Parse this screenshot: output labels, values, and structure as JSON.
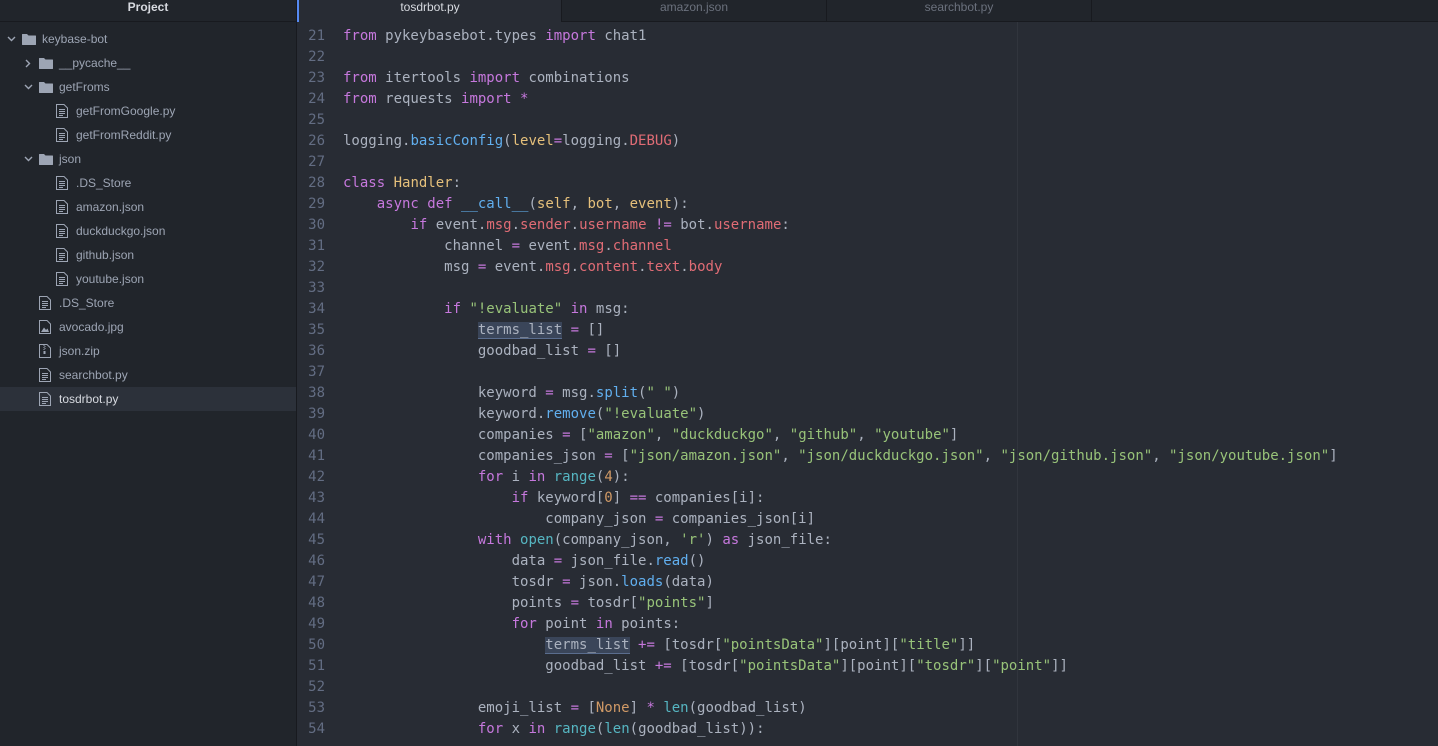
{
  "sidebar": {
    "title": "Project",
    "tree": [
      {
        "label": "keybase-bot",
        "type": "folder",
        "depth": 0,
        "expanded": true,
        "selected": false
      },
      {
        "label": "__pycache__",
        "type": "folder",
        "depth": 1,
        "expanded": false,
        "selected": false
      },
      {
        "label": "getFroms",
        "type": "folder",
        "depth": 1,
        "expanded": true,
        "selected": false
      },
      {
        "label": "getFromGoogle.py",
        "type": "file",
        "depth": 2,
        "selected": false
      },
      {
        "label": "getFromReddit.py",
        "type": "file",
        "depth": 2,
        "selected": false
      },
      {
        "label": "json",
        "type": "folder",
        "depth": 1,
        "expanded": true,
        "selected": false
      },
      {
        "label": ".DS_Store",
        "type": "file",
        "depth": 2,
        "selected": false
      },
      {
        "label": "amazon.json",
        "type": "file",
        "depth": 2,
        "selected": false
      },
      {
        "label": "duckduckgo.json",
        "type": "file",
        "depth": 2,
        "selected": false
      },
      {
        "label": "github.json",
        "type": "file",
        "depth": 2,
        "selected": false
      },
      {
        "label": "youtube.json",
        "type": "file",
        "depth": 2,
        "selected": false
      },
      {
        "label": ".DS_Store",
        "type": "file",
        "depth": 1,
        "selected": false
      },
      {
        "label": "avocado.jpg",
        "type": "image",
        "depth": 1,
        "selected": false
      },
      {
        "label": "json.zip",
        "type": "zip",
        "depth": 1,
        "selected": false
      },
      {
        "label": "searchbot.py",
        "type": "file",
        "depth": 1,
        "selected": false
      },
      {
        "label": "tosdrbot.py",
        "type": "file",
        "depth": 1,
        "selected": true
      }
    ]
  },
  "tabs": [
    {
      "label": "tosdrbot.py",
      "active": true
    },
    {
      "label": "amazon.json",
      "active": false
    },
    {
      "label": "searchbot.py",
      "active": false
    }
  ],
  "editor": {
    "lines": [
      {
        "n": "21",
        "tokens": [
          [
            "kw",
            "from"
          ],
          [
            "t",
            " pykeybasebot"
          ],
          [
            "t",
            "."
          ],
          [
            "t",
            "types "
          ],
          [
            "kw",
            "import"
          ],
          [
            "t",
            " chat1"
          ]
        ]
      },
      {
        "n": "22",
        "tokens": []
      },
      {
        "n": "23",
        "tokens": [
          [
            "kw",
            "from"
          ],
          [
            "t",
            " itertools "
          ],
          [
            "kw",
            "import"
          ],
          [
            "t",
            " combinations"
          ]
        ]
      },
      {
        "n": "24",
        "tokens": [
          [
            "kw",
            "from"
          ],
          [
            "t",
            " requests "
          ],
          [
            "kw",
            "import"
          ],
          [
            "t",
            " "
          ],
          [
            "kw",
            "*"
          ]
        ]
      },
      {
        "n": "25",
        "tokens": []
      },
      {
        "n": "26",
        "tokens": [
          [
            "t",
            "logging."
          ],
          [
            "fn",
            "basicConfig"
          ],
          [
            "t",
            "("
          ],
          [
            "par",
            "level"
          ],
          [
            "kw",
            "="
          ],
          [
            "t",
            "logging."
          ],
          [
            "prop",
            "DEBUG"
          ],
          [
            "t",
            ")"
          ]
        ]
      },
      {
        "n": "27",
        "tokens": []
      },
      {
        "n": "28",
        "tokens": [
          [
            "kw",
            "class"
          ],
          [
            "t",
            " "
          ],
          [
            "cls",
            "Handler"
          ],
          [
            "t",
            ":"
          ]
        ]
      },
      {
        "n": "29",
        "tokens": [
          [
            "t",
            "    "
          ],
          [
            "kw",
            "async def"
          ],
          [
            "t",
            " "
          ],
          [
            "fn",
            "__call__"
          ],
          [
            "t",
            "("
          ],
          [
            "par",
            "self"
          ],
          [
            "t",
            ", "
          ],
          [
            "par",
            "bot"
          ],
          [
            "t",
            ", "
          ],
          [
            "par",
            "event"
          ],
          [
            "t",
            "):"
          ]
        ]
      },
      {
        "n": "30",
        "tokens": [
          [
            "t",
            "        "
          ],
          [
            "kw",
            "if"
          ],
          [
            "t",
            " event."
          ],
          [
            "prop",
            "msg"
          ],
          [
            "t",
            "."
          ],
          [
            "prop",
            "sender"
          ],
          [
            "t",
            "."
          ],
          [
            "prop",
            "username"
          ],
          [
            "t",
            " "
          ],
          [
            "kw",
            "!="
          ],
          [
            "t",
            " bot."
          ],
          [
            "prop",
            "username"
          ],
          [
            "t",
            ":"
          ]
        ]
      },
      {
        "n": "31",
        "tokens": [
          [
            "t",
            "            channel "
          ],
          [
            "kw",
            "="
          ],
          [
            "t",
            " event."
          ],
          [
            "prop",
            "msg"
          ],
          [
            "t",
            "."
          ],
          [
            "prop",
            "channel"
          ]
        ]
      },
      {
        "n": "32",
        "tokens": [
          [
            "t",
            "            msg "
          ],
          [
            "kw",
            "="
          ],
          [
            "t",
            " event."
          ],
          [
            "prop",
            "msg"
          ],
          [
            "t",
            "."
          ],
          [
            "prop",
            "content"
          ],
          [
            "t",
            "."
          ],
          [
            "prop",
            "text"
          ],
          [
            "t",
            "."
          ],
          [
            "prop",
            "body"
          ]
        ]
      },
      {
        "n": "33",
        "tokens": []
      },
      {
        "n": "34",
        "tokens": [
          [
            "t",
            "            "
          ],
          [
            "kw",
            "if"
          ],
          [
            "t",
            " "
          ],
          [
            "str",
            "\"!evaluate\""
          ],
          [
            "t",
            " "
          ],
          [
            "kw",
            "in"
          ],
          [
            "t",
            " msg:"
          ]
        ]
      },
      {
        "n": "35",
        "tokens": [
          [
            "t",
            "                "
          ],
          [
            "hl",
            "terms_list"
          ],
          [
            "t",
            " "
          ],
          [
            "kw",
            "="
          ],
          [
            "t",
            " []"
          ]
        ]
      },
      {
        "n": "36",
        "tokens": [
          [
            "t",
            "                goodbad_list "
          ],
          [
            "kw",
            "="
          ],
          [
            "t",
            " []"
          ]
        ]
      },
      {
        "n": "37",
        "tokens": []
      },
      {
        "n": "38",
        "tokens": [
          [
            "t",
            "                keyword "
          ],
          [
            "kw",
            "="
          ],
          [
            "t",
            " msg."
          ],
          [
            "fn",
            "split"
          ],
          [
            "t",
            "("
          ],
          [
            "str",
            "\" \""
          ],
          [
            "t",
            ")"
          ]
        ]
      },
      {
        "n": "39",
        "tokens": [
          [
            "t",
            "                keyword."
          ],
          [
            "fn",
            "remove"
          ],
          [
            "t",
            "("
          ],
          [
            "str",
            "\"!evaluate\""
          ],
          [
            "t",
            ")"
          ]
        ]
      },
      {
        "n": "40",
        "tokens": [
          [
            "t",
            "                companies "
          ],
          [
            "kw",
            "="
          ],
          [
            "t",
            " ["
          ],
          [
            "str",
            "\"amazon\""
          ],
          [
            "t",
            ", "
          ],
          [
            "str",
            "\"duckduckgo\""
          ],
          [
            "t",
            ", "
          ],
          [
            "str",
            "\"github\""
          ],
          [
            "t",
            ", "
          ],
          [
            "str",
            "\"youtube\""
          ],
          [
            "t",
            "]"
          ]
        ]
      },
      {
        "n": "41",
        "tokens": [
          [
            "t",
            "                companies_json "
          ],
          [
            "kw",
            "="
          ],
          [
            "t",
            " ["
          ],
          [
            "str",
            "\"json/amazon.json\""
          ],
          [
            "t",
            ", "
          ],
          [
            "str",
            "\"json/duckduckgo.json\""
          ],
          [
            "t",
            ", "
          ],
          [
            "str",
            "\"json/github.json\""
          ],
          [
            "t",
            ", "
          ],
          [
            "str",
            "\"json/youtube.json\""
          ],
          [
            "t",
            "]"
          ]
        ]
      },
      {
        "n": "42",
        "tokens": [
          [
            "t",
            "                "
          ],
          [
            "kw",
            "for"
          ],
          [
            "t",
            " i "
          ],
          [
            "kw",
            "in"
          ],
          [
            "t",
            " "
          ],
          [
            "sup",
            "range"
          ],
          [
            "t",
            "("
          ],
          [
            "num",
            "4"
          ],
          [
            "t",
            "):"
          ]
        ]
      },
      {
        "n": "43",
        "tokens": [
          [
            "t",
            "                    "
          ],
          [
            "kw",
            "if"
          ],
          [
            "t",
            " keyword["
          ],
          [
            "num",
            "0"
          ],
          [
            "t",
            "] "
          ],
          [
            "kw",
            "=="
          ],
          [
            "t",
            " companies[i]:"
          ]
        ]
      },
      {
        "n": "44",
        "tokens": [
          [
            "t",
            "                        company_json "
          ],
          [
            "kw",
            "="
          ],
          [
            "t",
            " companies_json[i]"
          ]
        ]
      },
      {
        "n": "45",
        "tokens": [
          [
            "t",
            "                "
          ],
          [
            "kw",
            "with"
          ],
          [
            "t",
            " "
          ],
          [
            "sup",
            "open"
          ],
          [
            "t",
            "(company_json, "
          ],
          [
            "str",
            "'r'"
          ],
          [
            "t",
            ") "
          ],
          [
            "kw",
            "as"
          ],
          [
            "t",
            " json_file:"
          ]
        ]
      },
      {
        "n": "46",
        "tokens": [
          [
            "t",
            "                    data "
          ],
          [
            "kw",
            "="
          ],
          [
            "t",
            " json_file."
          ],
          [
            "fn",
            "read"
          ],
          [
            "t",
            "()"
          ]
        ]
      },
      {
        "n": "47",
        "tokens": [
          [
            "t",
            "                    tosdr "
          ],
          [
            "kw",
            "="
          ],
          [
            "t",
            " json."
          ],
          [
            "fn",
            "loads"
          ],
          [
            "t",
            "(data)"
          ]
        ]
      },
      {
        "n": "48",
        "tokens": [
          [
            "t",
            "                    points "
          ],
          [
            "kw",
            "="
          ],
          [
            "t",
            " tosdr["
          ],
          [
            "str",
            "\"points\""
          ],
          [
            "t",
            "]"
          ]
        ]
      },
      {
        "n": "49",
        "tokens": [
          [
            "t",
            "                    "
          ],
          [
            "kw",
            "for"
          ],
          [
            "t",
            " point "
          ],
          [
            "kw",
            "in"
          ],
          [
            "t",
            " points:"
          ]
        ]
      },
      {
        "n": "50",
        "tokens": [
          [
            "t",
            "                        "
          ],
          [
            "hl",
            "terms_list"
          ],
          [
            "t",
            " "
          ],
          [
            "kw",
            "+="
          ],
          [
            "t",
            " [tosdr["
          ],
          [
            "str",
            "\"pointsData\""
          ],
          [
            "t",
            "][point]["
          ],
          [
            "str",
            "\"title\""
          ],
          [
            "t",
            "]]"
          ]
        ]
      },
      {
        "n": "51",
        "tokens": [
          [
            "t",
            "                        goodbad_list "
          ],
          [
            "kw",
            "+="
          ],
          [
            "t",
            " [tosdr["
          ],
          [
            "str",
            "\"pointsData\""
          ],
          [
            "t",
            "][point]["
          ],
          [
            "str",
            "\"tosdr\""
          ],
          [
            "t",
            "]["
          ],
          [
            "str",
            "\"point\""
          ],
          [
            "t",
            "]]"
          ]
        ]
      },
      {
        "n": "52",
        "tokens": []
      },
      {
        "n": "53",
        "tokens": [
          [
            "t",
            "                emoji_list "
          ],
          [
            "kw",
            "="
          ],
          [
            "t",
            " ["
          ],
          [
            "num",
            "None"
          ],
          [
            "t",
            "] "
          ],
          [
            "kw",
            "*"
          ],
          [
            "t",
            " "
          ],
          [
            "sup",
            "len"
          ],
          [
            "t",
            "(goodbad_list)"
          ]
        ]
      },
      {
        "n": "54",
        "tokens": [
          [
            "t",
            "                "
          ],
          [
            "kw",
            "for"
          ],
          [
            "t",
            " x "
          ],
          [
            "kw",
            "in"
          ],
          [
            "t",
            " "
          ],
          [
            "sup",
            "range"
          ],
          [
            "t",
            "("
          ],
          [
            "sup",
            "len"
          ],
          [
            "t",
            "(goodbad_list)):"
          ]
        ]
      }
    ]
  },
  "colors": {
    "sidebar_bg": "#21252b",
    "editor_bg": "#282c34",
    "accent": "#568af2",
    "keyword": "#c678dd",
    "string": "#98c379",
    "function": "#61afef",
    "property": "#e06c75"
  },
  "icons": {
    "folder": "folder-icon",
    "file": "file-text-icon",
    "image": "image-file-icon",
    "zip": "zip-file-icon",
    "expanded": "chevron-down-icon",
    "collapsed": "chevron-right-icon"
  }
}
